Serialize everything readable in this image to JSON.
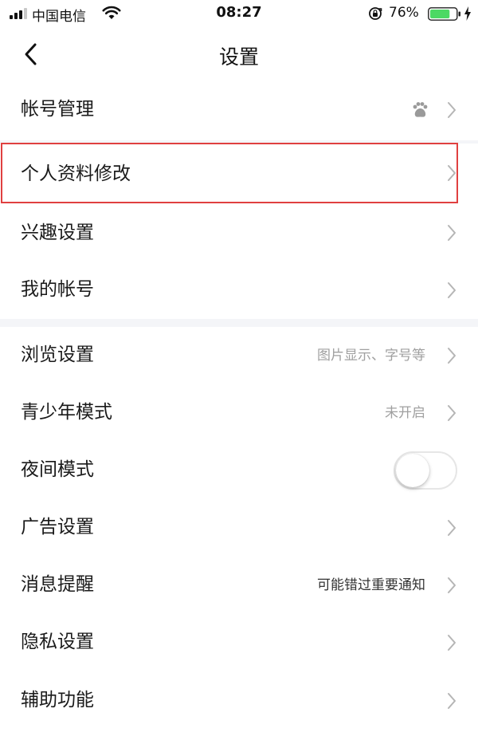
{
  "status_bar": {
    "carrier": "中国电信",
    "time": "08:27",
    "battery_percent": "76%",
    "battery_level": 0.76,
    "icons": [
      "signal-icon",
      "wifi-icon",
      "rotation-lock-icon",
      "battery-icon",
      "charging-icon"
    ]
  },
  "nav": {
    "title": "设置",
    "back_icon": "chevron-left-icon"
  },
  "settings": {
    "account_management": {
      "label": "帐号管理",
      "icon": "paw-icon"
    },
    "profile_edit": {
      "label": "个人资料修改"
    },
    "interest_settings": {
      "label": "兴趣设置"
    },
    "my_account": {
      "label": "我的帐号"
    },
    "browse_settings": {
      "label": "浏览设置",
      "value": "图片显示、字号等"
    },
    "youth_mode": {
      "label": "青少年模式",
      "value": "未开启"
    },
    "night_mode": {
      "label": "夜间模式",
      "enabled": false
    },
    "ad_settings": {
      "label": "广告设置"
    },
    "message_reminder": {
      "label": "消息提醒",
      "value": "可能错过重要通知"
    },
    "privacy_settings": {
      "label": "隐私设置"
    },
    "accessibility": {
      "label": "辅助功能"
    }
  },
  "colors": {
    "highlight_border": "#e04040",
    "battery_fill": "#4cd964",
    "section_gap": "#f4f5f8",
    "secondary_text": "#a0a0a0"
  }
}
